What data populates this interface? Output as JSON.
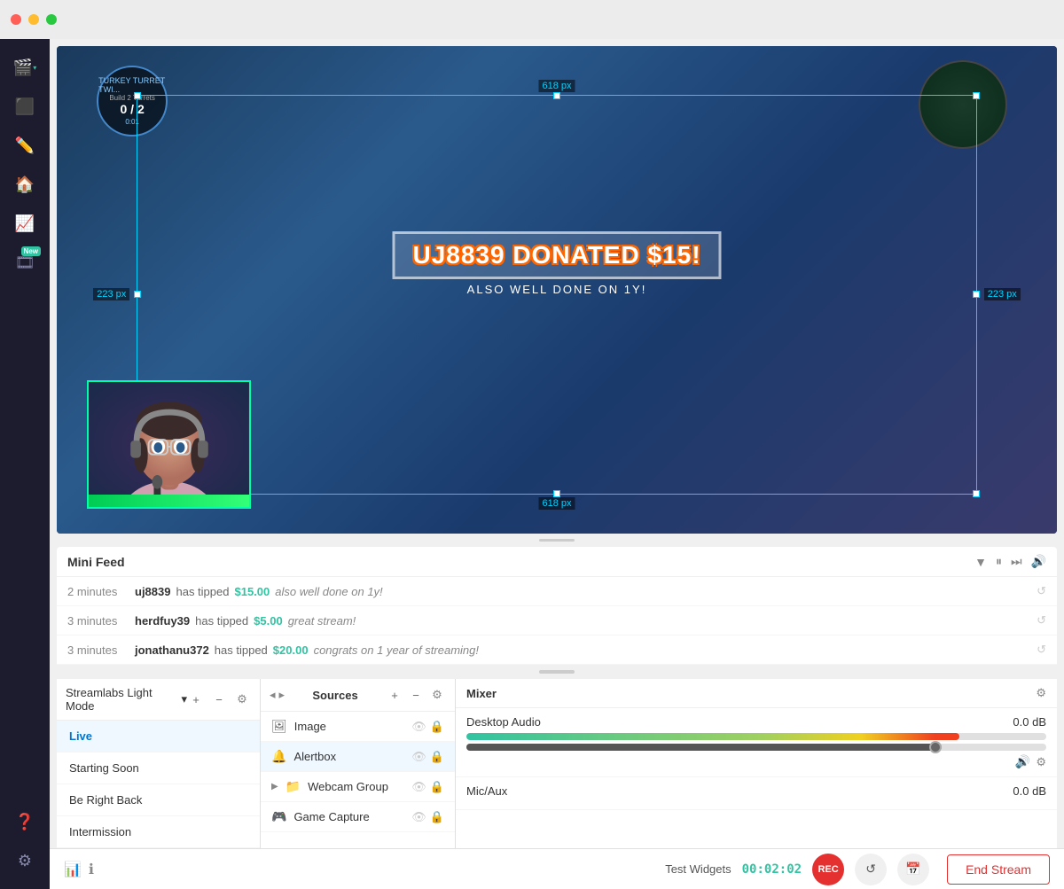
{
  "titlebar": {
    "dot_red": "red",
    "dot_yellow": "yellow",
    "dot_green": "green"
  },
  "sidebar": {
    "items": [
      {
        "id": "camera",
        "icon": "🎬",
        "active": true
      },
      {
        "id": "scenes",
        "icon": "⬛"
      },
      {
        "id": "tools",
        "icon": "🔧"
      },
      {
        "id": "home",
        "icon": "🏠"
      },
      {
        "id": "analytics",
        "icon": "📈"
      },
      {
        "id": "new-feature",
        "icon": "🎞",
        "badge": "New"
      },
      {
        "id": "help-bottom",
        "icon": "❓",
        "bottom": true
      },
      {
        "id": "settings-bottom",
        "icon": "⚙",
        "bottom": true
      }
    ]
  },
  "preview": {
    "selection": {
      "width_label": "618 px",
      "height_left": "223 px",
      "height_right": "223 px"
    },
    "donation": {
      "text": "UJ8839 DONATED $15!",
      "sub": "ALSO WELL DONE ON 1Y!"
    }
  },
  "mini_feed": {
    "title": "Mini Feed",
    "items": [
      {
        "time": "2 minutes",
        "user": "uj8839",
        "action": "has tipped",
        "amount": "$15.00",
        "message": "also well done on 1y!"
      },
      {
        "time": "3 minutes",
        "user": "herdfuy39",
        "action": "has tipped",
        "amount": "$5.00",
        "message": "great stream!"
      },
      {
        "time": "3 minutes",
        "user": "jonathanu372",
        "action": "has tipped",
        "amount": "$20.00",
        "message": "congrats on 1 year of streaming!"
      }
    ]
  },
  "scenes": {
    "mode_label": "Streamlabs Light Mode",
    "items": [
      {
        "name": "Live",
        "header": true
      },
      {
        "name": "Starting Soon"
      },
      {
        "name": "Be Right Back"
      },
      {
        "name": "Intermission"
      }
    ]
  },
  "sources": {
    "title": "Sources",
    "items": [
      {
        "name": "Image",
        "icon": "🖼"
      },
      {
        "name": "Alertbox",
        "icon": "🔔",
        "active": true
      },
      {
        "name": "Webcam Group",
        "icon": "📁",
        "expand": true
      },
      {
        "name": "Game Capture",
        "icon": "🎮"
      }
    ]
  },
  "mixer": {
    "title": "Mixer",
    "channels": [
      {
        "name": "Desktop Audio",
        "db": "0.0 dB",
        "bar_width": "85%"
      },
      {
        "name": "Mic/Aux",
        "db": "0.0 dB",
        "bar_width": "0%"
      }
    ]
  },
  "status_bar": {
    "test_widgets_label": "Test Widgets",
    "timer": "00:02:02",
    "rec_label": "REC",
    "end_stream_label": "End Stream"
  }
}
